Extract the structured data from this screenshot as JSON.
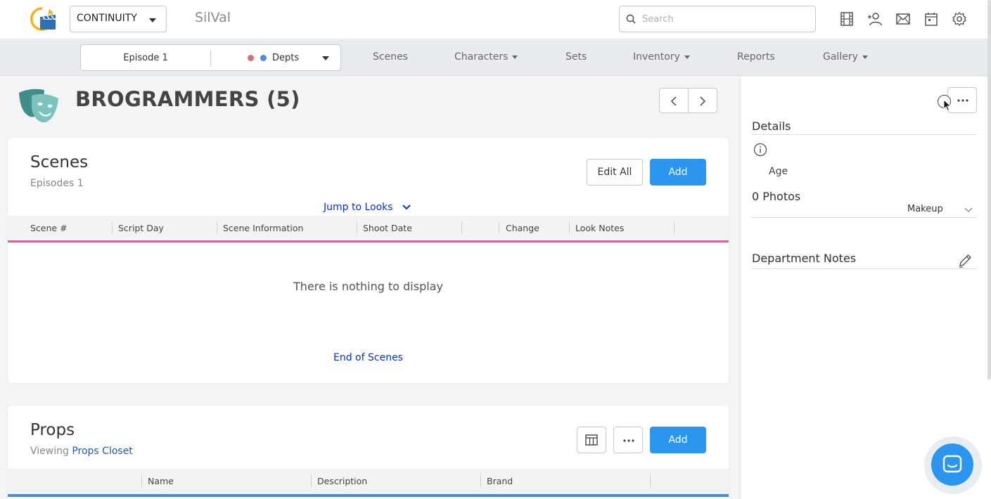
{
  "topbar": {
    "app_mode": "CONTINUITY",
    "project_name": "SilVal",
    "search_placeholder": "Search",
    "search_value": ""
  },
  "nav": {
    "episode": "Episode 1",
    "depts_label": "Depts",
    "dept_dot_colors": [
      "#e26b7b",
      "#4a8ed8"
    ],
    "items": [
      {
        "label": "Scenes",
        "dropdown": false
      },
      {
        "label": "Characters",
        "dropdown": true
      },
      {
        "label": "Sets",
        "dropdown": false
      },
      {
        "label": "Inventory",
        "dropdown": true
      },
      {
        "label": "Reports",
        "dropdown": false
      },
      {
        "label": "Gallery",
        "dropdown": true
      }
    ]
  },
  "page": {
    "title": "BROGRAMMERS (5)"
  },
  "scenes": {
    "title": "Scenes",
    "subtitle": "Episodes 1",
    "edit_all_label": "Edit All",
    "add_label": "Add",
    "jump_label": "Jump to Looks",
    "columns": [
      "Scene #",
      "Script Day",
      "Scene Information",
      "Shoot Date",
      "Change",
      "Look Notes"
    ],
    "empty_message": "There is nothing to display",
    "end_message": "End of Scenes"
  },
  "props": {
    "title": "Props",
    "viewing_label": "Viewing",
    "viewing_link": "Props Closet",
    "add_label": "Add",
    "columns": [
      "Name",
      "Description",
      "Brand"
    ]
  },
  "panel": {
    "details_title": "Details",
    "age_label": "Age",
    "photos_title": "0 Photos",
    "photos_filter": "Makeup",
    "dept_notes_title": "Department Notes"
  },
  "colors": {
    "primary": "#2c95f0",
    "link": "#0a34b8",
    "scenes_accent": "#d3639b",
    "props_accent": "#3c8fe0",
    "mask_color": "#3f8e8a"
  }
}
